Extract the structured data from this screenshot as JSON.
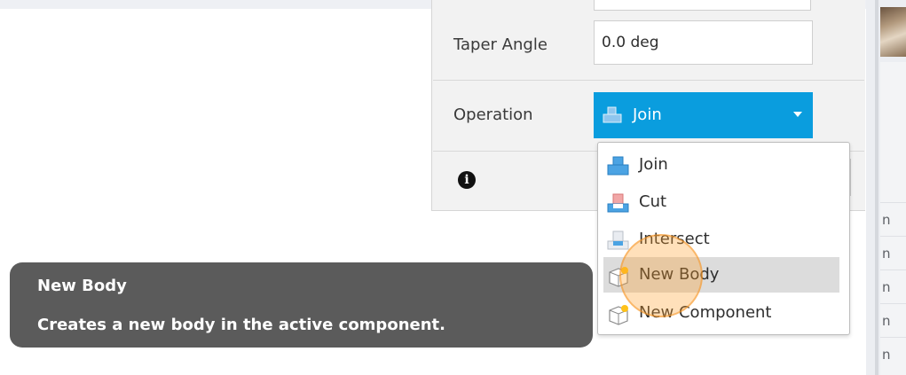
{
  "panel": {
    "taper_angle_label": "Taper Angle",
    "taper_angle_value": "0.0 deg",
    "operation_label": "Operation"
  },
  "operation_select": {
    "value": "Join",
    "icon": "join-icon"
  },
  "operation_menu": {
    "items": [
      {
        "label": "Join",
        "icon": "join-icon"
      },
      {
        "label": "Cut",
        "icon": "cut-icon"
      },
      {
        "label": "Intersect",
        "icon": "intersect-icon"
      },
      {
        "label": "New Body",
        "icon": "new-body-icon"
      },
      {
        "label": "New Component",
        "icon": "new-component-icon"
      }
    ],
    "highlighted": "New Body"
  },
  "tooltip": {
    "title": "New Body",
    "description": "Creates a new body in the active component."
  },
  "right_strip": {
    "row_text": [
      "n",
      "n",
      "n",
      "n",
      "n"
    ]
  },
  "colors": {
    "select_background": "#0a9dde",
    "tooltip_background": "#5b5b5b",
    "cursor_highlight": "#f5a23c",
    "menu_hover": "#dcdcdc"
  }
}
